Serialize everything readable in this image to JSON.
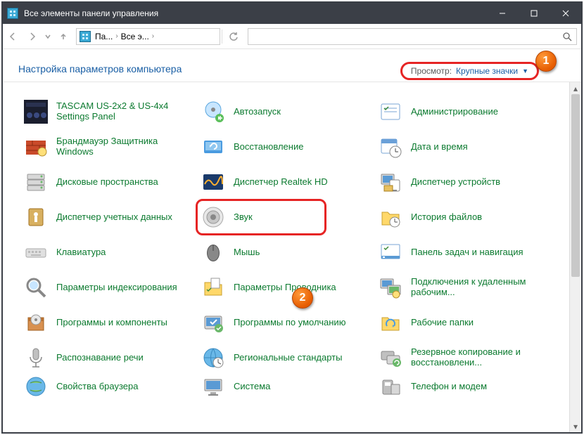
{
  "titlebar": {
    "title": "Все элементы панели управления"
  },
  "breadcrumb": {
    "seg1": "Па...",
    "seg2": "Все э..."
  },
  "header": {
    "text": "Настройка параметров компьютера"
  },
  "view": {
    "label": "Просмотр:",
    "value": "Крупные значки"
  },
  "annotations": {
    "badge1": "1",
    "badge2": "2"
  },
  "items": {
    "c0": [
      "TASCAM US-2x2 & US-4x4 Settings Panel",
      "Брандмауэр Защитника Windows",
      "Дисковые пространства",
      "Диспетчер учетных данных",
      "Клавиатура",
      "Параметры индексирования",
      "Программы и компоненты",
      "Распознавание речи",
      "Свойства браузера"
    ],
    "c1": [
      "Автозапуск",
      "Восстановление",
      "Диспетчер Realtek HD",
      "Звук",
      "Мышь",
      "Параметры Проводника",
      "Программы по умолчанию",
      "Региональные стандарты",
      "Система"
    ],
    "c2": [
      "Администрирование",
      "Дата и время",
      "Диспетчер устройств",
      "История файлов",
      "Панель задач и навигация",
      "Подключения к удаленным рабочим...",
      "Рабочие папки",
      "Резервное копирование и восстановлени...",
      "Телефон и модем"
    ]
  }
}
